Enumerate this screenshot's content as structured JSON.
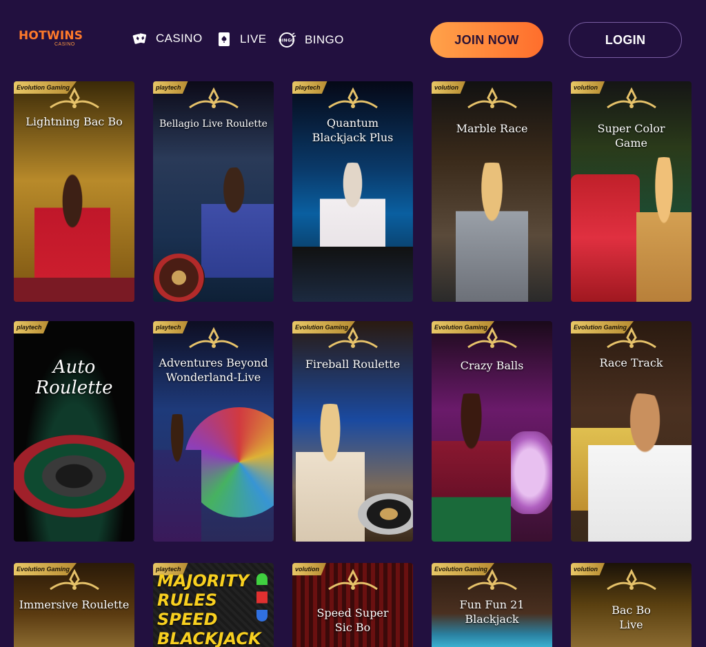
{
  "header": {
    "logo_text": "HOTWINS",
    "logo_sub": "CASINO",
    "nav": [
      {
        "label": "CASINO",
        "icon": "cards-icon"
      },
      {
        "label": "LIVE",
        "icon": "card-ace-icon"
      },
      {
        "label": "BINGO",
        "icon": "bingo-ball-icon"
      }
    ],
    "join_label": "JOIN NOW",
    "login_label": "LOGIN"
  },
  "games": [
    {
      "title": "Lightning Bac Bo",
      "badge": "Evolution Gaming"
    },
    {
      "title": "Bellagio Live Roulette",
      "badge": "playtech"
    },
    {
      "title": "Quantum Blackjack Plus",
      "badge": "playtech"
    },
    {
      "title": "Marble Race",
      "badge": "volution"
    },
    {
      "title": "Super Color Game",
      "badge": "volution"
    },
    {
      "title": "Auto Roulette",
      "badge": "playtech"
    },
    {
      "title": "Adventures Beyond Wonderland-Live",
      "badge": "playtech"
    },
    {
      "title": "Fireball Roulette",
      "badge": "Evolution Gaming"
    },
    {
      "title": "Crazy Balls",
      "badge": "Evolution Gaming"
    },
    {
      "title": "Race Track",
      "badge": "Evolution Gaming"
    },
    {
      "title": "Immersive Roulette",
      "badge": "Evolution Gaming"
    },
    {
      "title": "MAJORITY RULES SPEED BLACKJACK",
      "badge": "playtech"
    },
    {
      "title": "Speed Super Sic Bo",
      "badge": "volution"
    },
    {
      "title": "Fun Fun 21 Blackjack",
      "badge": "Evolution Gaming"
    },
    {
      "title": "Bac Bo Live",
      "badge": "volution"
    }
  ]
}
